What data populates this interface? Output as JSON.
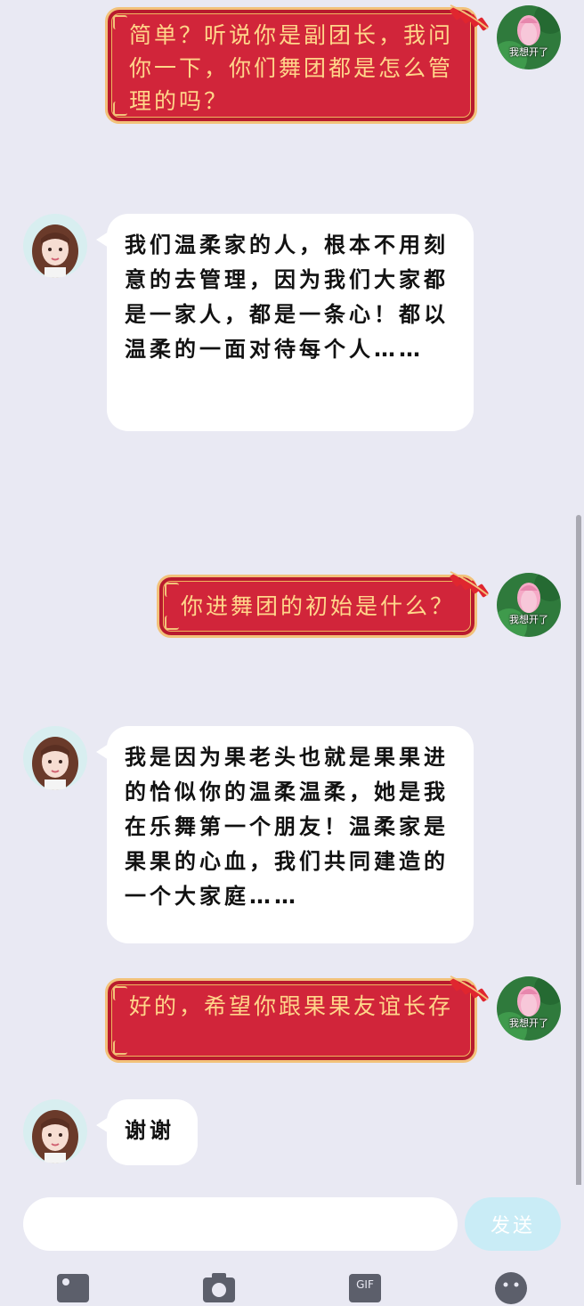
{
  "messages": [
    {
      "side": "sent",
      "text": "简单？听说你是副团长，我问你一下，你们舞团都是怎么管理的吗？"
    },
    {
      "side": "received",
      "text": "我们温柔家的人，根本不用刻意的去管理，因为我们大家都是一家人，都是一条心！都以温柔的一面对待每个人……"
    },
    {
      "side": "sent",
      "text": "你进舞团的初始是什么？"
    },
    {
      "side": "received",
      "text": "我是因为果老头也就是果果进的恰似你的温柔温柔，她是我在乐舞第一个朋友！温柔家是果果的心血，我们共同建造的一个大家庭……"
    },
    {
      "side": "sent",
      "text": "好的，希望你跟果果友谊长存"
    },
    {
      "side": "received",
      "text": "谢谢"
    }
  ],
  "self_avatar_label": "我想开了",
  "input": {
    "placeholder": ""
  },
  "send_button_label": "发送",
  "toolbar_icons": [
    "image-icon",
    "camera-icon",
    "gif-icon",
    "emoji-icon"
  ],
  "colors": {
    "sent_bubble": "#d1253a",
    "sent_text": "#ffd68a",
    "received_bubble": "#ffffff",
    "background": "#e9e9f3",
    "send_button": "#c9ecf6"
  }
}
